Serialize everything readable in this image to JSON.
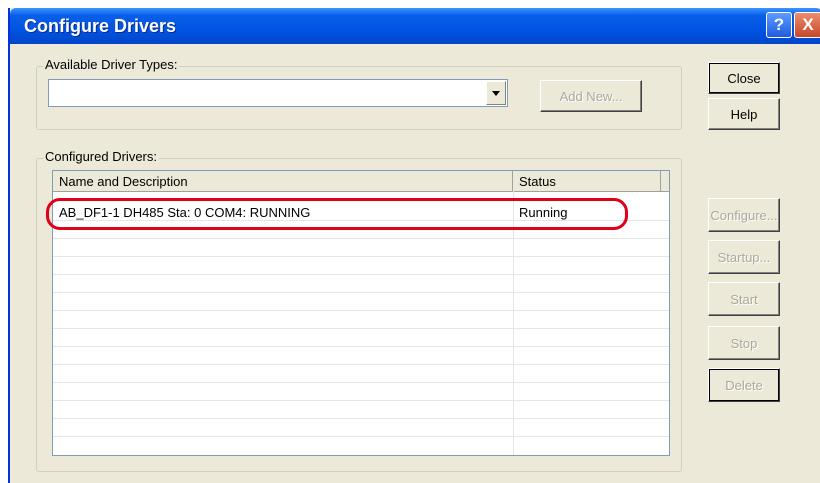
{
  "window": {
    "title": "Configure Drivers"
  },
  "titlebar": {
    "help_glyph": "?",
    "close_glyph": "X"
  },
  "available": {
    "group_label": "Available Driver Types:",
    "selected_value": "",
    "add_new_label": "Add New..."
  },
  "side_buttons": {
    "close": "Close",
    "help": "Help",
    "configure": "Configure...",
    "startup": "Startup...",
    "start": "Start",
    "stop": "Stop",
    "delete": "Delete"
  },
  "configured": {
    "group_label": "Configured Drivers:",
    "columns": [
      "Name and Description",
      "Status"
    ],
    "rows": [
      {
        "name": "AB_DF1-1 DH485 Sta: 0 COM4: RUNNING",
        "status": "Running"
      }
    ]
  },
  "annotation": {
    "color": "#e0001a"
  }
}
